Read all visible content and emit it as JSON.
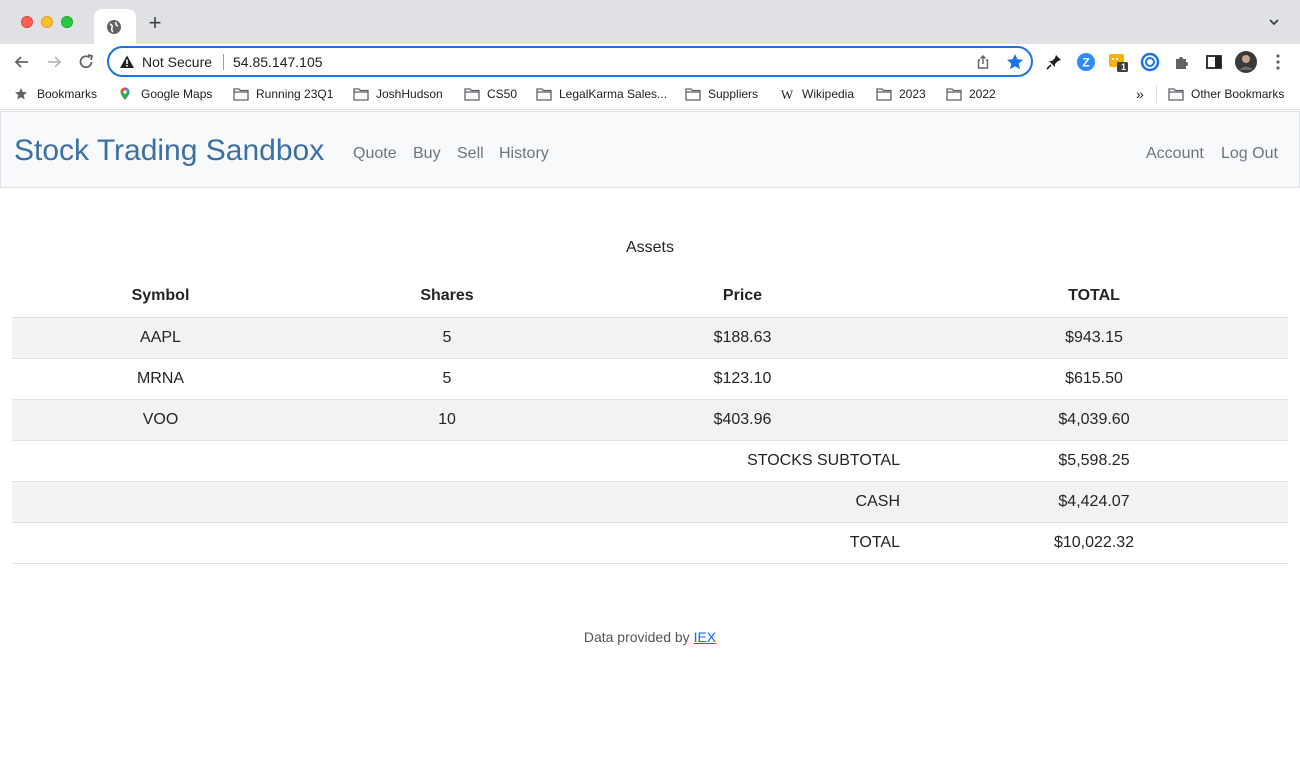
{
  "browser": {
    "omnibox": {
      "security_text": "Not Secure",
      "url": "54.85.147.105"
    },
    "bookmarks": [
      {
        "label": "Bookmarks",
        "icon": "star-icon"
      },
      {
        "label": "Google Maps",
        "icon": "maps-pin-icon"
      },
      {
        "label": "Running 23Q1",
        "icon": "folder-icon"
      },
      {
        "label": "JoshHudson",
        "icon": "folder-icon"
      },
      {
        "label": "CS50",
        "icon": "folder-icon"
      },
      {
        "label": "LegalKarma Sales...",
        "icon": "folder-icon"
      },
      {
        "label": "Suppliers",
        "icon": "folder-icon"
      },
      {
        "label": "Wikipedia",
        "icon": "wikipedia-icon"
      },
      {
        "label": "2023",
        "icon": "folder-icon"
      },
      {
        "label": "2022",
        "icon": "folder-icon"
      }
    ],
    "overflow": "»",
    "other_bookmarks": "Other Bookmarks",
    "extension_badge": "1"
  },
  "navbar": {
    "brand": "Stock Trading Sandbox",
    "links": [
      "Quote",
      "Buy",
      "Sell",
      "History"
    ],
    "right_links": [
      "Account",
      "Log Out"
    ]
  },
  "main": {
    "title": "Assets",
    "columns": [
      "Symbol",
      "Shares",
      "Price",
      "TOTAL"
    ],
    "rows": [
      {
        "symbol": "AAPL",
        "shares": "5",
        "price": "$188.63",
        "total": "$943.15"
      },
      {
        "symbol": "MRNA",
        "shares": "5",
        "price": "$123.10",
        "total": "$615.50"
      },
      {
        "symbol": "VOO",
        "shares": "10",
        "price": "$403.96",
        "total": "$4,039.60"
      }
    ],
    "summary": [
      {
        "label": "STOCKS SUBTOTAL",
        "value": "$5,598.25"
      },
      {
        "label": "CASH",
        "value": "$4,424.07"
      },
      {
        "label": "TOTAL",
        "value": "$10,022.32"
      }
    ]
  },
  "footer": {
    "text": "Data provided by",
    "link": "IEX"
  },
  "colors": {
    "brand": "#3c6fa3",
    "accent": "#1a73e8",
    "stripe": "#f2f2f2",
    "navbar_bg": "#f8f9fa"
  }
}
